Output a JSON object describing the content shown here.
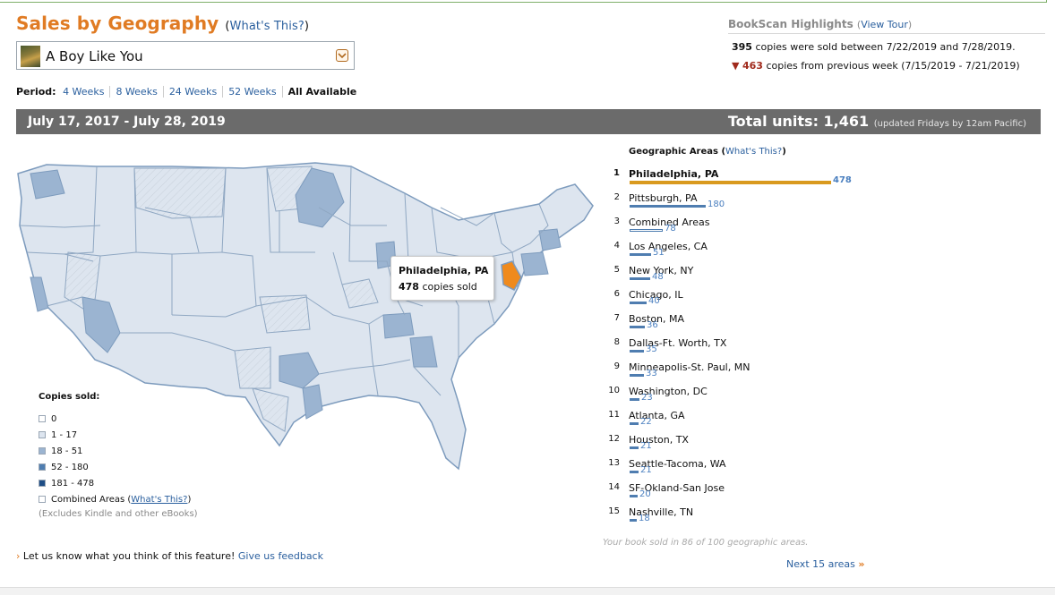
{
  "page": {
    "title": "Sales by Geography",
    "title_help": "What's This?",
    "selected_book": "A Boy Like You"
  },
  "period": {
    "label": "Period:",
    "options": [
      "4 Weeks",
      "8 Weeks",
      "24 Weeks",
      "52 Weeks",
      "All Available"
    ],
    "active": "All Available"
  },
  "bookscan": {
    "heading": "BookScan Highlights",
    "tour_link": "View Tour",
    "line1_count": "395",
    "line1_text": "copies were sold between 7/22/2019 and 7/28/2019.",
    "line2_count": "463",
    "line2_text": "copies from previous week (7/15/2019 - 7/21/2019)"
  },
  "summary": {
    "date_range": "July 17, 2017 - July 28, 2019",
    "total_label": "Total units: 1,461",
    "updated_note": "(updated Fridays by 12am Pacific)"
  },
  "tooltip": {
    "city": "Philadelphia, PA",
    "copies": "478",
    "copies_suffix": "copies sold"
  },
  "legend": {
    "title": "Copies sold:",
    "items": [
      {
        "label": "0",
        "color": "#ffffff"
      },
      {
        "label": "1 - 17",
        "color": "#dde5ef"
      },
      {
        "label": "18 - 51",
        "color": "#9bb4d1"
      },
      {
        "label": "52 - 180",
        "color": "#4f7db0"
      },
      {
        "label": "181 - 478",
        "color": "#1f4e86"
      }
    ],
    "combined_label": "Combined Areas (",
    "combined_link": "What's This?",
    "combined_close": ")",
    "note": "(Excludes Kindle and other eBooks)"
  },
  "feedback": {
    "text": "Let us know what you think of this feature!",
    "link": "Give us feedback"
  },
  "areas": {
    "heading": "Geographic Areas",
    "help": "What's This?",
    "max": 478,
    "top_color": "#d99a1f",
    "bar_color": "#4f7db0",
    "list": [
      {
        "rank": "1",
        "city": "Philadelphia, PA",
        "copies": 478
      },
      {
        "rank": "2",
        "city": "Pittsburgh, PA",
        "copies": 180
      },
      {
        "rank": "3",
        "city": "Combined Areas",
        "copies": 78
      },
      {
        "rank": "4",
        "city": "Los Angeles, CA",
        "copies": 51
      },
      {
        "rank": "5",
        "city": "New York, NY",
        "copies": 48
      },
      {
        "rank": "6",
        "city": "Chicago, IL",
        "copies": 40
      },
      {
        "rank": "7",
        "city": "Boston, MA",
        "copies": 36
      },
      {
        "rank": "8",
        "city": "Dallas-Ft. Worth, TX",
        "copies": 35
      },
      {
        "rank": "9",
        "city": "Minneapolis-St. Paul, MN",
        "copies": 33
      },
      {
        "rank": "10",
        "city": "Washington, DC",
        "copies": 23
      },
      {
        "rank": "11",
        "city": "Atlanta, GA",
        "copies": 22
      },
      {
        "rank": "12",
        "city": "Houston, TX",
        "copies": 21
      },
      {
        "rank": "13",
        "city": "Seattle-Tacoma, WA",
        "copies": 21
      },
      {
        "rank": "14",
        "city": "SF-Okland-San Jose",
        "copies": 20
      },
      {
        "rank": "15",
        "city": "Nashville, TN",
        "copies": 18
      }
    ],
    "sold_in": "Your book sold in 86 of 100 geographic areas.",
    "next_label": "Next 15 areas"
  }
}
